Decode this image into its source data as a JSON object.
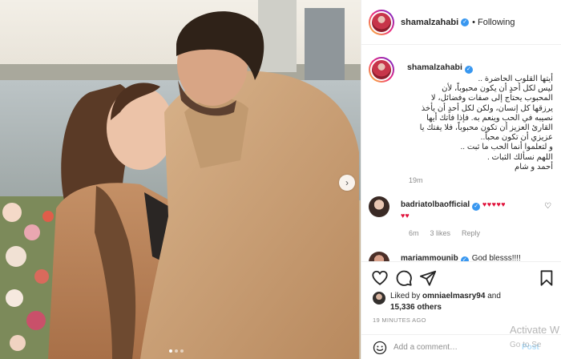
{
  "post": {
    "username": "shamalzahabi",
    "verified_glyph": "✓",
    "follow_separator": "•",
    "follow_status": "Following",
    "caption_lines": [
      "أيتها القلوب الحاضرة ..",
      "ليس لكل أحدٍ أن يكون محبوباً، لأن",
      "المحبوب يحتاج إلى صفات وفضائل، لا",
      "يرزقها كل إنسان، ولكن لكل أحدٍ أن يأخذ",
      "نصيبه في الحب وينعم به. فإذا فاتك أيها",
      "القارئ العزيز أن تكون محبوباً، فلا يفتك يا",
      "عزيزي أن تكون محباً..",
      "و لتعلموا أنما الحب ما ثبت ..",
      "اللهم نسألك الثبات .",
      "أحمد و شام"
    ],
    "caption_time": "19m",
    "next_icon": "chevron-right-icon",
    "next_glyph": "›"
  },
  "comments": [
    {
      "username": "badriatolbaofficial",
      "text_hearts_line1": "♥♥♥♥♥",
      "text_hearts_line2": "♥♥",
      "time": "6m",
      "likes": "3 likes",
      "reply": "Reply",
      "like_glyph": "♡"
    },
    {
      "username": "mariammounib",
      "text": "God blesss!!!!"
    }
  ],
  "actions": {
    "liked_by_prefix": "Liked by",
    "liked_by_user": "omniaelmasry94",
    "liked_by_and": "and",
    "others_count": "15,336 others",
    "time_ago": "19 MINUTES AGO",
    "comment_placeholder": "Add a comment…",
    "post_label": "Post"
  },
  "overlay": {
    "watermark_line1": "Activate W",
    "watermark_line2": "Go to Se"
  },
  "colors": {
    "verified": "#3897f0",
    "hearts": "#e0113a",
    "muted": "#8e8e8e",
    "post_disabled": "#b2dffc"
  }
}
